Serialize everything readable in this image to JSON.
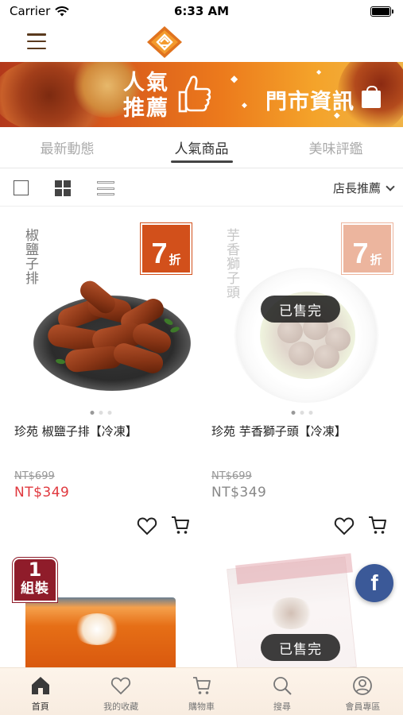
{
  "status_bar": {
    "carrier": "Carrier",
    "time": "6:33 AM"
  },
  "banner": {
    "hot_line1": "人氣",
    "hot_line2": "推薦",
    "store_info": "門市資訊"
  },
  "tabs": [
    {
      "label": "最新動態",
      "active": false
    },
    {
      "label": "人氣商品",
      "active": true
    },
    {
      "label": "美味評鑑",
      "active": false
    }
  ],
  "toolbar": {
    "sort_label": "店長推薦"
  },
  "products": [
    {
      "vertical_name": "椒鹽子排",
      "discount_num": "7",
      "discount_unit": "折",
      "title": "珍苑 椒鹽子排【冷凍】",
      "old_price": "NT$699",
      "price": "NT$349",
      "sold_out": false
    },
    {
      "vertical_name": "芋香獅子頭",
      "discount_num": "7",
      "discount_unit": "折",
      "title": "珍苑 芋香獅子頭【冷凍】",
      "old_price": "NT$699",
      "price": "NT$349",
      "sold_out": true,
      "sold_out_label": "已售完"
    },
    {
      "badge_num": "1",
      "badge_text": "組裝"
    },
    {
      "sold_out": true,
      "sold_out_label": "已售完"
    }
  ],
  "facebook": {
    "label": "f"
  },
  "tabbar": [
    {
      "label": "首頁",
      "icon": "home-icon",
      "active": true
    },
    {
      "label": "我的收藏",
      "icon": "heart-icon",
      "active": false
    },
    {
      "label": "購物車",
      "icon": "cart-icon",
      "active": false
    },
    {
      "label": "搜尋",
      "icon": "search-icon",
      "active": false
    },
    {
      "label": "會員專區",
      "icon": "user-icon",
      "active": false
    }
  ],
  "colors": {
    "accent": "#e0383e",
    "brand_orange": "#d2501b",
    "facebook": "#3b5998"
  }
}
